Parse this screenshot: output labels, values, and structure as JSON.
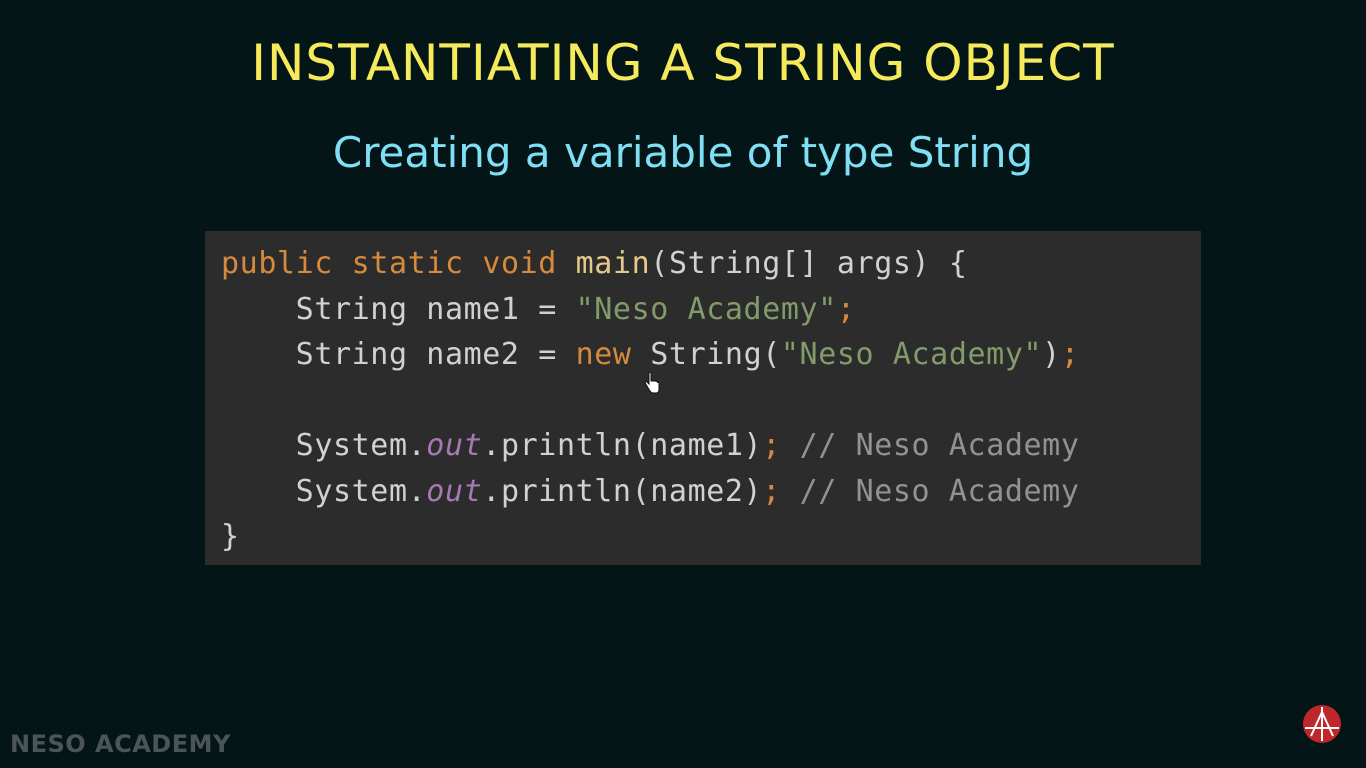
{
  "slide": {
    "title": "INSTANTIATING A STRING OBJECT",
    "subtitle": "Creating a variable of type String"
  },
  "code": {
    "line1": {
      "public": "public",
      "static": "static",
      "void": "void",
      "main": "main",
      "params": "(String[] args) {"
    },
    "line2": {
      "decl": "String name1 = ",
      "literal": "\"Neso Academy\"",
      "semicolon": ";"
    },
    "line3": {
      "decl": "String name2 = ",
      "new": "new",
      "ctor": " String(",
      "literal": "\"Neso Academy\"",
      "close": ")",
      "semicolon": ";"
    },
    "line5": {
      "system": "System.",
      "out": "out",
      "call": ".println(name1)",
      "semicolon": ";",
      "comment": "// Neso Academy"
    },
    "line6": {
      "system": "System.",
      "out": "out",
      "call": ".println(name2)",
      "semicolon": ";",
      "comment": "// Neso Academy"
    },
    "line7": {
      "brace": "}"
    }
  },
  "branding": {
    "watermark": "NESO ACADEMY"
  },
  "colors": {
    "background": "#041517",
    "title": "#f4ea5b",
    "subtitle": "#7fdff5",
    "code_panel": "#2c2c2c",
    "keyword": "#d58a3e",
    "string_literal": "#829b6a",
    "static_field": "#a57ab2",
    "comment": "#8f9396",
    "logo": "#c0272d"
  },
  "icons": {
    "cursor": "mouse-pointer-hand-icon",
    "logo": "neso-academy-logo-icon"
  }
}
